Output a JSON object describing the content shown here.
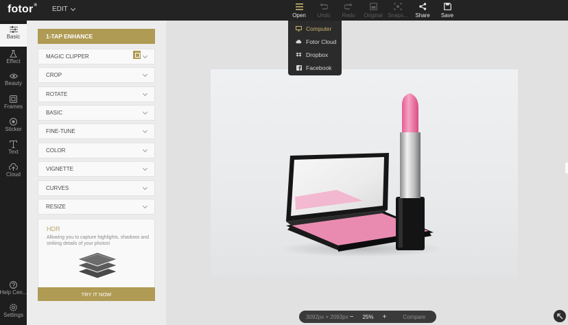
{
  "app": {
    "logo": "fotor",
    "logo_mark": "®",
    "mode": "EDIT"
  },
  "toolbar": [
    {
      "id": "open",
      "label": "Open",
      "icon": "menu-icon",
      "active": true
    },
    {
      "id": "undo",
      "label": "Undo",
      "icon": "undo-icon",
      "active": false
    },
    {
      "id": "redo",
      "label": "Redo",
      "icon": "redo-icon",
      "active": false
    },
    {
      "id": "original",
      "label": "Original",
      "icon": "original-icon",
      "active": false
    },
    {
      "id": "snapshot",
      "label": "Snaps...",
      "icon": "snapshot-icon",
      "active": false
    },
    {
      "id": "share",
      "label": "Share",
      "icon": "share-icon",
      "active": true
    },
    {
      "id": "save",
      "label": "Save",
      "icon": "save-icon",
      "active": true
    }
  ],
  "open_menu": [
    {
      "label": "Computer",
      "icon": "monitor-icon",
      "active": true
    },
    {
      "label": "Fotor Cloud",
      "icon": "cloud-icon",
      "active": false
    },
    {
      "label": "Dropbox",
      "icon": "dropbox-icon",
      "active": false
    },
    {
      "label": "Facebook",
      "icon": "facebook-icon",
      "active": false
    }
  ],
  "rail": [
    {
      "label": "Basic",
      "icon": "sliders-icon",
      "active": true
    },
    {
      "label": "Effect",
      "icon": "flask-icon",
      "active": false
    },
    {
      "label": "Beauty",
      "icon": "eye-icon",
      "active": false
    },
    {
      "label": "Frames",
      "icon": "frame-icon",
      "active": false
    },
    {
      "label": "Sticker",
      "icon": "sticker-icon",
      "active": false
    },
    {
      "label": "Text",
      "icon": "text-icon",
      "active": false
    },
    {
      "label": "Cloud",
      "icon": "cloud-upload-icon",
      "active": false
    }
  ],
  "rail_bottom": [
    {
      "label": "Help Cen...",
      "icon": "help-icon"
    },
    {
      "label": "Settings",
      "icon": "settings-icon"
    }
  ],
  "panel": {
    "enhance_label": "1-TAP ENHANCE",
    "sections": [
      "MAGIC CLIPPER",
      "CROP",
      "ROTATE",
      "BASIC",
      "FINE-TUNE",
      "COLOR",
      "VIGNETTE",
      "CURVES",
      "RESIZE"
    ],
    "hdr": {
      "title": "HDR",
      "description": "Allowing you to capture highlights, shadows and striking details of your photos!",
      "button": "TRY IT NOW"
    }
  },
  "status": {
    "dimensions": "3092px × 2093px",
    "zoom_out": "−",
    "zoom": "25%",
    "zoom_in": "+",
    "compare": "Compare"
  },
  "colors": {
    "accent_gold": "#b09b55",
    "topbar": "#232323",
    "panel_bg": "#ececec",
    "canvas_bg": "#e1e1e1"
  }
}
